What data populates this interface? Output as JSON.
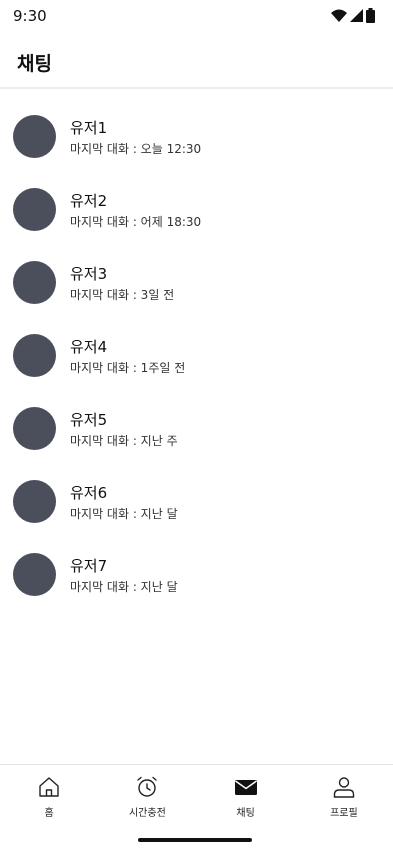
{
  "status_bar": {
    "time": "9:30"
  },
  "header": {
    "title": "채팅"
  },
  "chats": [
    {
      "name": "유저1",
      "last_message": "마지막 대화 : 오늘 12:30"
    },
    {
      "name": "유저2",
      "last_message": "마지막 대화 : 어제 18:30"
    },
    {
      "name": "유저3",
      "last_message": "마지막 대화 : 3일 전"
    },
    {
      "name": "유저4",
      "last_message": "마지막 대화 : 1주일 전"
    },
    {
      "name": "유저5",
      "last_message": "마지막 대화 : 지난 주"
    },
    {
      "name": "유저6",
      "last_message": "마지막 대화 : 지난 달"
    },
    {
      "name": "유저7",
      "last_message": "마지막 대화 : 지난 달"
    }
  ],
  "bottom_nav": [
    {
      "label": "홈",
      "icon": "home-icon"
    },
    {
      "label": "시간충전",
      "icon": "alarm-clock-icon"
    },
    {
      "label": "채팅",
      "icon": "mail-icon"
    },
    {
      "label": "프로필",
      "icon": "user-icon"
    }
  ],
  "colors": {
    "avatar": "#4b4f5c",
    "divider": "#ececec",
    "text": "#111111"
  }
}
